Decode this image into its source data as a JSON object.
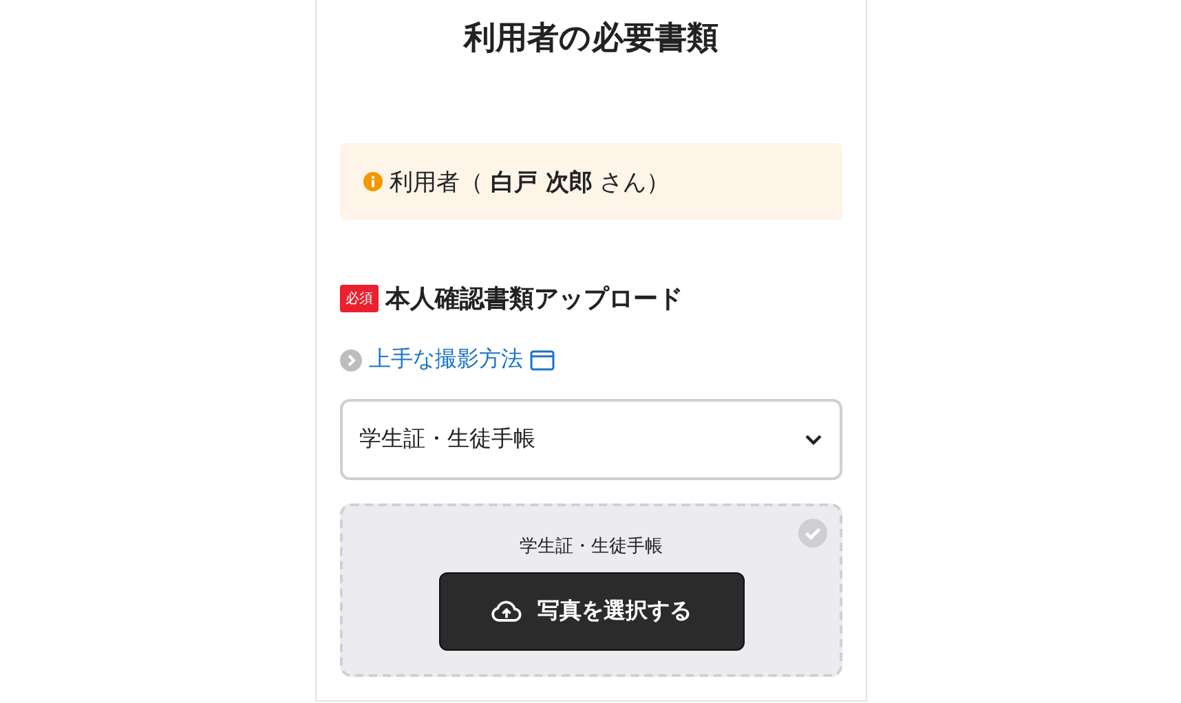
{
  "title": "利用者の必要書類",
  "notice": {
    "text": "利用者（ **白戸 次郎** さん）"
  },
  "section": {
    "badge": "必須",
    "heading": "本人確認書類アップロード"
  },
  "help_link": {
    "label": "上手な撮影方法"
  },
  "document_select": {
    "value": "学生証・生徒手帳"
  },
  "upload": {
    "label": "学生証・生徒手帳",
    "button": "写真を選択する",
    "completed": false
  }
}
